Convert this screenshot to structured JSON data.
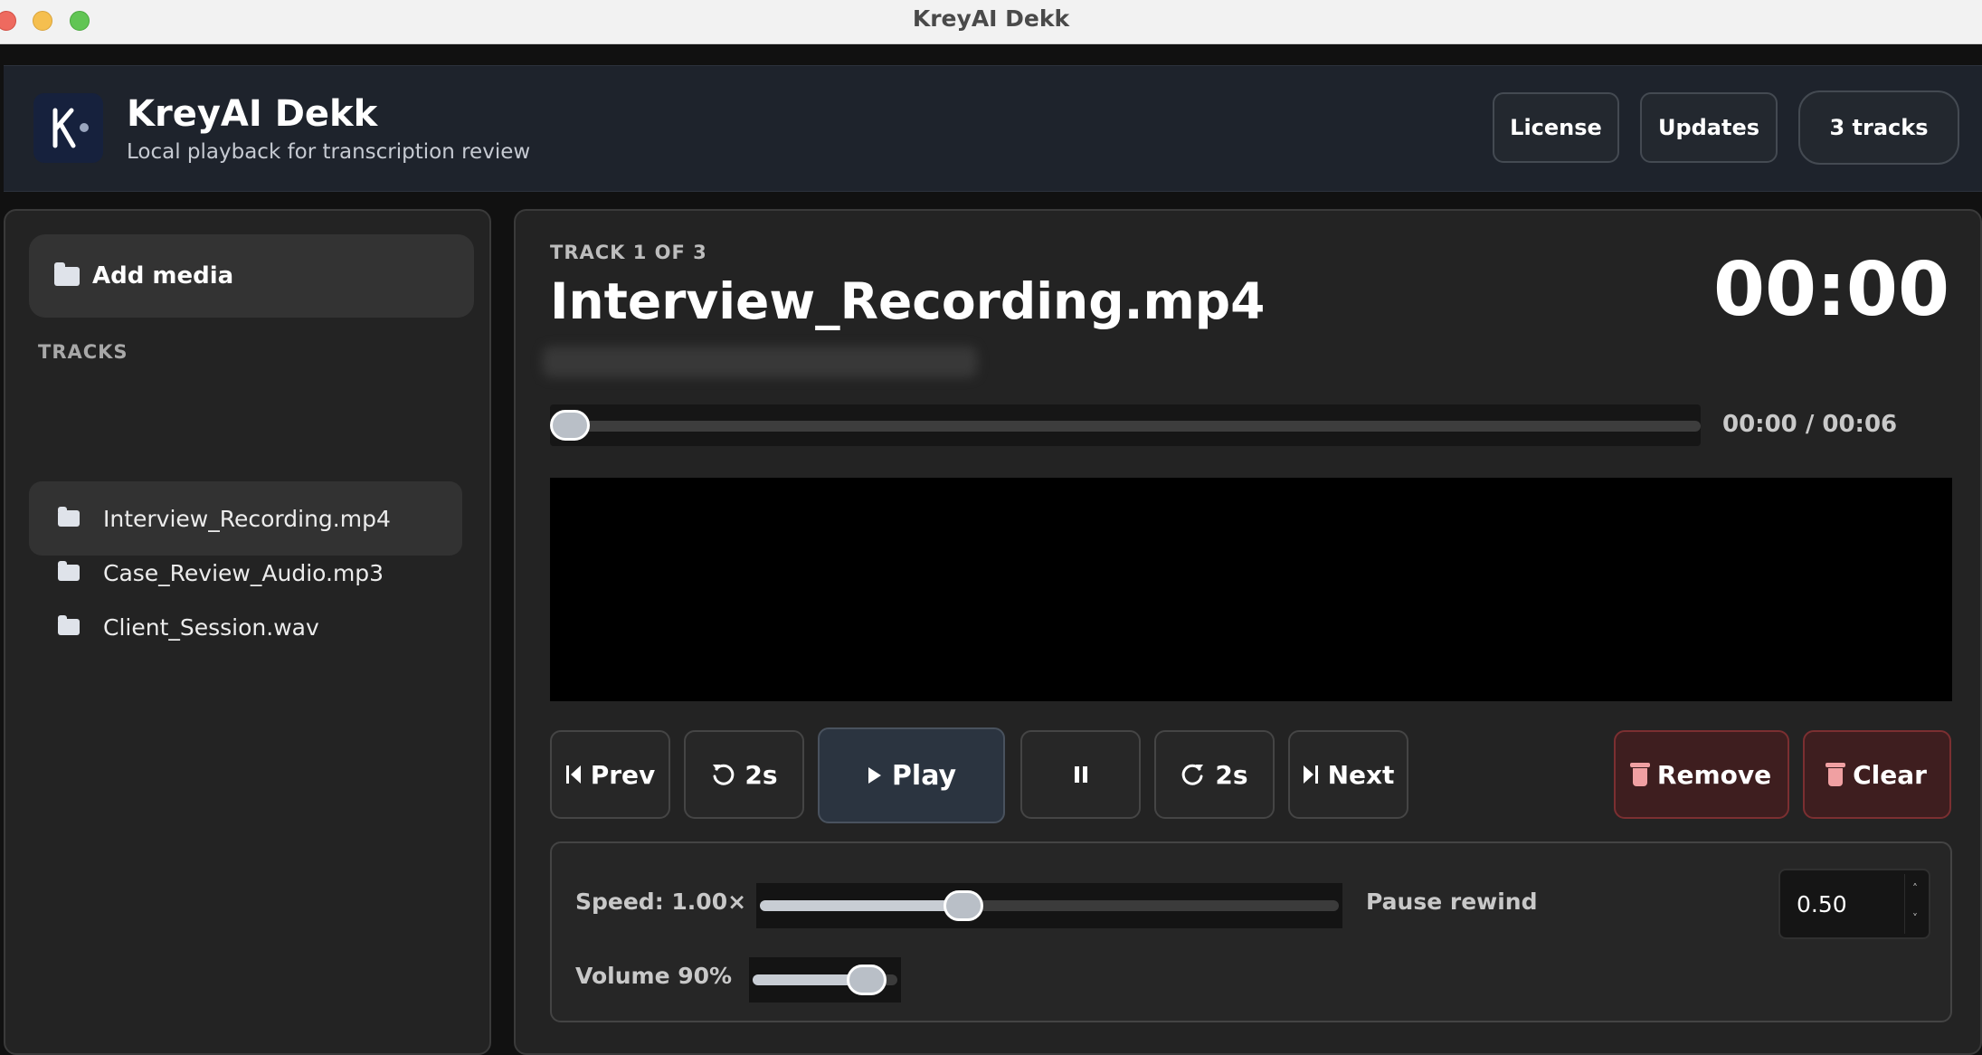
{
  "window": {
    "title": "KreyAI Dekk"
  },
  "header": {
    "app_name": "KreyAI Dekk",
    "subtitle": "Local playback for transcription review",
    "license_label": "License",
    "updates_label": "Updates",
    "tracks_badge": "3 tracks"
  },
  "sidebar": {
    "add_media_label": "Add media",
    "tracks_heading": "TRACKS",
    "tracks": [
      {
        "name": "Interview_Recording.mp4",
        "active": true
      },
      {
        "name": "Case_Review_Audio.mp3",
        "active": false
      },
      {
        "name": "Client_Session.wav",
        "active": false
      }
    ]
  },
  "player": {
    "track_counter": "TRACK 1 OF 3",
    "title": "Interview_Recording.mp4",
    "current_time_large": "00:00",
    "time_readout": "00:00 / 00:06",
    "seek_progress": 0.0
  },
  "controls": {
    "prev_label": "Prev",
    "rewind_label": "2s",
    "play_label": "Play",
    "forward_label": "2s",
    "next_label": "Next",
    "remove_label": "Remove",
    "clear_label": "Clear"
  },
  "settings": {
    "speed_label": "Speed: 1.00×",
    "speed_fraction": 0.34,
    "pause_rewind_label": "Pause rewind",
    "pause_rewind_value": "0.50",
    "volume_label": "Volume 90%",
    "volume_fraction": 0.9
  },
  "colors": {
    "accent_danger": "#7b2f31",
    "play_button_bg": "#2b3440",
    "header_bg": "#1e232c"
  }
}
